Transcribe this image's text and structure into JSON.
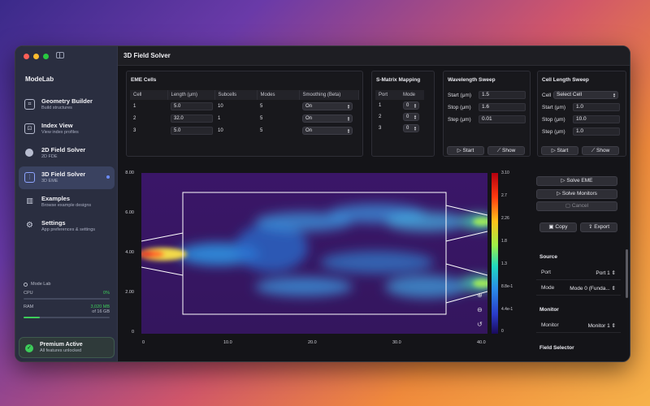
{
  "sidebar": {
    "app_title": "ModeLab",
    "items": [
      {
        "title": "Geometry Builder",
        "subtitle": "Build structures",
        "icon": "geometry-icon"
      },
      {
        "title": "Index View",
        "subtitle": "View index profiles",
        "icon": "index-icon"
      },
      {
        "title": "2D Field Solver",
        "subtitle": "2D FDE",
        "icon": "circle-icon"
      },
      {
        "title": "3D Field Solver",
        "subtitle": "3D EME",
        "icon": "grid-icon"
      },
      {
        "title": "Examples",
        "subtitle": "Browse example designs",
        "icon": "chart-icon"
      },
      {
        "title": "Settings",
        "subtitle": "App preferences & settings",
        "icon": "gear-icon"
      }
    ],
    "system": {
      "label": "Mode Lab",
      "cpu_label": "CPU",
      "cpu_value": "0%",
      "cpu_fraction": 0.0,
      "ram_label": "RAM",
      "ram_value": "3,020 MB",
      "ram_total": "of 16 GB",
      "ram_fraction": 0.19
    },
    "premium": {
      "title": "Premium Active",
      "subtitle": "All features unlocked"
    }
  },
  "main": {
    "title": "3D Field Solver",
    "eme": {
      "title": "EME Cells",
      "headers": [
        "Cell",
        "Length (μm)",
        "Subcells",
        "Modes",
        "Smoothing (Beta)"
      ],
      "rows": [
        {
          "cell": "1",
          "length": "5.0",
          "subcells": "10",
          "modes": "5",
          "smoothing": "On"
        },
        {
          "cell": "2",
          "length": "32.0",
          "subcells": "1",
          "modes": "5",
          "smoothing": "On"
        },
        {
          "cell": "3",
          "length": "5.0",
          "subcells": "10",
          "modes": "5",
          "smoothing": "On"
        }
      ]
    },
    "smap": {
      "title": "S-Matrix Mapping",
      "headers": [
        "Port",
        "Mode"
      ],
      "rows": [
        {
          "port": "1",
          "mode": "0"
        },
        {
          "port": "2",
          "mode": "0"
        },
        {
          "port": "3",
          "mode": "0"
        }
      ]
    },
    "wave": {
      "title": "Wavelength Sweep",
      "start_label": "Start (μm)",
      "start": "1.5",
      "stop_label": "Stop (μm)",
      "stop": "1.6",
      "step_label": "Step (μm)",
      "step": "0.01",
      "start_btn": "Start",
      "show_btn": "Show"
    },
    "cell": {
      "title": "Cell Length Sweep",
      "cell_label": "Cell",
      "cell_select": "Select Cell",
      "start_label": "Start (μm)",
      "start": "1.0",
      "stop_label": "Stop (μm)",
      "stop": "10.0",
      "step_label": "Step (μm)",
      "step": "1.0",
      "start_btn": "Start",
      "show_btn": "Show"
    },
    "plot": {
      "y_ticks": [
        "8.00",
        "6.00",
        "4.00",
        "2.00",
        "0"
      ],
      "x_ticks": [
        "0",
        "10.0",
        "20.0",
        "30.0",
        "40.0"
      ],
      "colorbar_ticks": [
        "3.10",
        "2.7",
        "2.26",
        "1.8",
        "1.3",
        "8.8e-1",
        "4.4e-1",
        "0"
      ]
    },
    "actions": {
      "solve_eme": "Solve EME",
      "solve_monitors": "Solve Monitors",
      "cancel": "Cancel",
      "copy": "Copy",
      "export": "Export"
    },
    "source": {
      "title": "Source",
      "port_label": "Port",
      "port_value": "Port 1",
      "mode_label": "Mode",
      "mode_value": "Mode 0 (Funda..."
    },
    "monitor": {
      "title": "Monitor",
      "monitor_label": "Monitor",
      "monitor_value": "Monitor 1"
    },
    "field_selector": {
      "title": "Field Selector"
    }
  },
  "colors": {
    "accent": "#6c8cff",
    "success": "#3dcc5a",
    "sidebar_bg": "#2a2e40",
    "plot_bg": "#3a1a6a"
  }
}
